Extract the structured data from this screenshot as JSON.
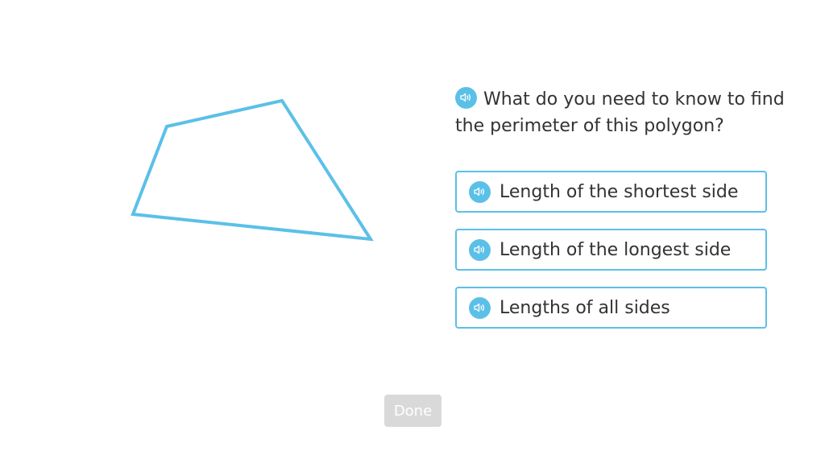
{
  "question": {
    "text": "What do you need to know to find the perimeter of this polygon?",
    "audio_icon": "speaker-icon"
  },
  "options": [
    {
      "label": "Length of the shortest side",
      "audio_icon": "speaker-icon"
    },
    {
      "label": "Length of the longest side",
      "audio_icon": "speaker-icon"
    },
    {
      "label": "Lengths of all sides",
      "audio_icon": "speaker-icon"
    }
  ],
  "done_button": {
    "label": "Done",
    "enabled": false
  },
  "colors": {
    "accent": "#5bc0e8",
    "text": "#333333",
    "done_disabled_bg": "#d9d9d9",
    "done_disabled_text": "#ffffff"
  }
}
